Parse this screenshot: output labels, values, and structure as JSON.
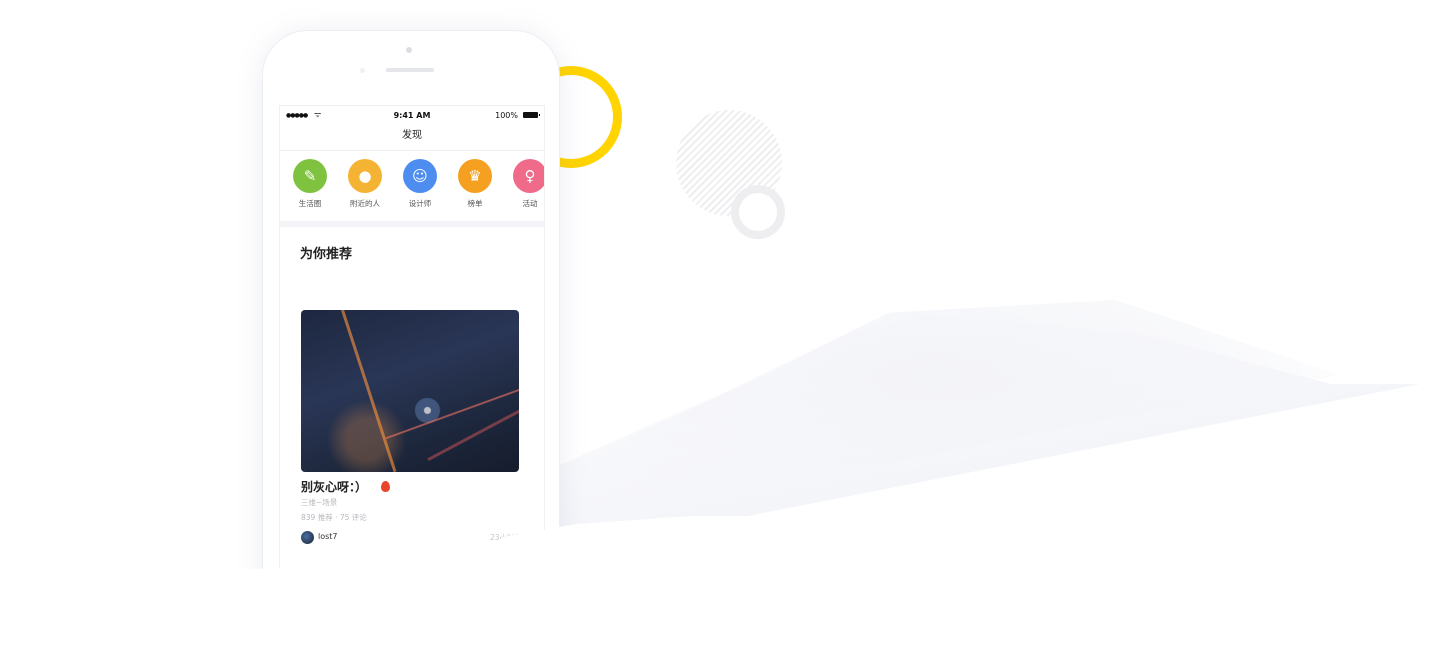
{
  "status_bar": {
    "signal": "●●●●●",
    "wifi": "ᯤ",
    "time": "9:41 AM",
    "battery": "100%"
  },
  "nav": {
    "title": "发现"
  },
  "categories": [
    {
      "label": "生活圈",
      "icon": "leaf-icon",
      "color": "#7ec240",
      "glyph": "✎"
    },
    {
      "label": "附近的人",
      "icon": "location-pin-icon",
      "color": "#f5b334",
      "glyph": "●"
    },
    {
      "label": "设计师",
      "icon": "designer-face-icon",
      "color": "#4d8df0",
      "glyph": "☺"
    },
    {
      "label": "榜单",
      "icon": "crown-icon",
      "color": "#f5a020",
      "glyph": "♛"
    },
    {
      "label": "活动",
      "icon": "balloon-icon",
      "color": "#f06b8a",
      "glyph": "♀"
    }
  ],
  "recommend": {
    "title": "为你推荐",
    "post": {
      "title": "别灰心呀：）",
      "subtitle": "三维~场景",
      "stats": "839 推荐 · 75 评论",
      "author": "lost7",
      "time": "23小时前"
    }
  },
  "colors": {
    "accent_yellow": "#ffd400",
    "fire": "#e8452c"
  }
}
